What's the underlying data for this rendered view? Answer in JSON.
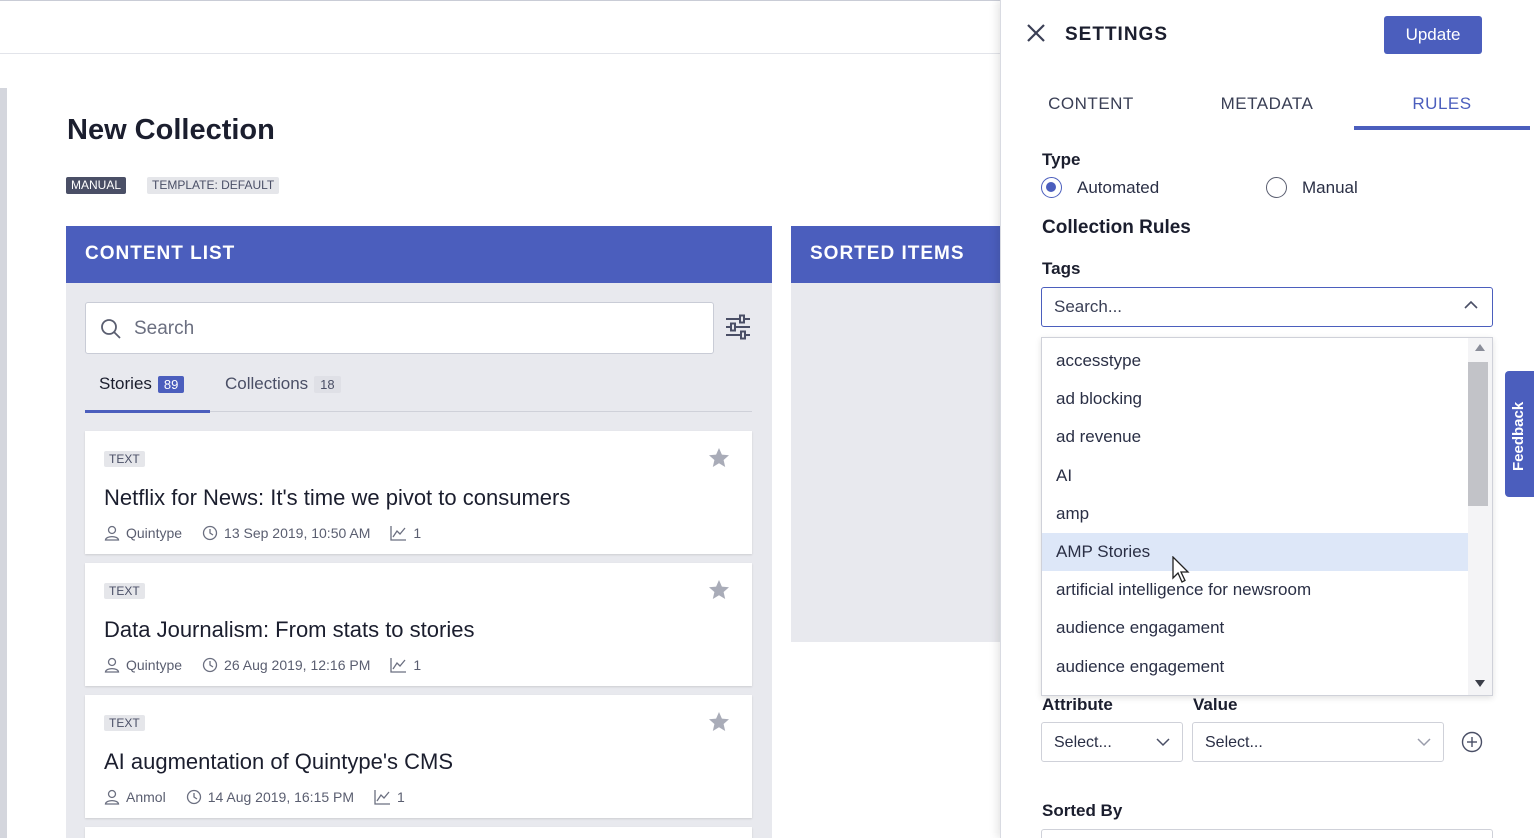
{
  "page": {
    "title": "New Collection",
    "badge_manual": "MANUAL",
    "badge_template": "TEMPLATE: DEFAULT"
  },
  "content_list": {
    "header": "CONTENT LIST",
    "search_placeholder": "Search",
    "tabs": [
      {
        "label": "Stories",
        "count": "89"
      },
      {
        "label": "Collections",
        "count": "18"
      }
    ],
    "cards": [
      {
        "type": "TEXT",
        "title": "Netflix for News: It's time we pivot to consumers",
        "author": "Quintype",
        "date": "13 Sep 2019, 10:50 AM",
        "views": "1"
      },
      {
        "type": "TEXT",
        "title": "Data Journalism: From stats to stories",
        "author": "Quintype",
        "date": "26 Aug 2019, 12:16 PM",
        "views": "1"
      },
      {
        "type": "TEXT",
        "title": "AI augmentation of Quintype's CMS",
        "author": "Anmol",
        "date": "14 Aug 2019, 16:15 PM",
        "views": "1"
      }
    ]
  },
  "sorted_items": {
    "header": "SORTED ITEMS"
  },
  "settings": {
    "title": "SETTINGS",
    "update_label": "Update",
    "tabs": [
      "CONTENT",
      "METADATA",
      "RULES"
    ],
    "type_label": "Type",
    "type_options": [
      "Automated",
      "Manual"
    ],
    "collection_rules_label": "Collection Rules",
    "tags_label": "Tags",
    "tags_placeholder": "Search...",
    "tag_options": [
      "accesstype",
      "ad blocking",
      "ad revenue",
      "AI",
      "amp",
      "AMP Stories",
      "artificial intelligence for newsroom",
      "audience engagament",
      "audience engagement"
    ],
    "attribute_label": "Attribute",
    "value_label": "Value",
    "attribute_select": "Select...",
    "value_select": "Select...",
    "sorted_by_label": "Sorted By"
  },
  "feedback": "Feedback",
  "colors": {
    "accent": "#4b5ebd",
    "hover": "#dde7f8"
  }
}
